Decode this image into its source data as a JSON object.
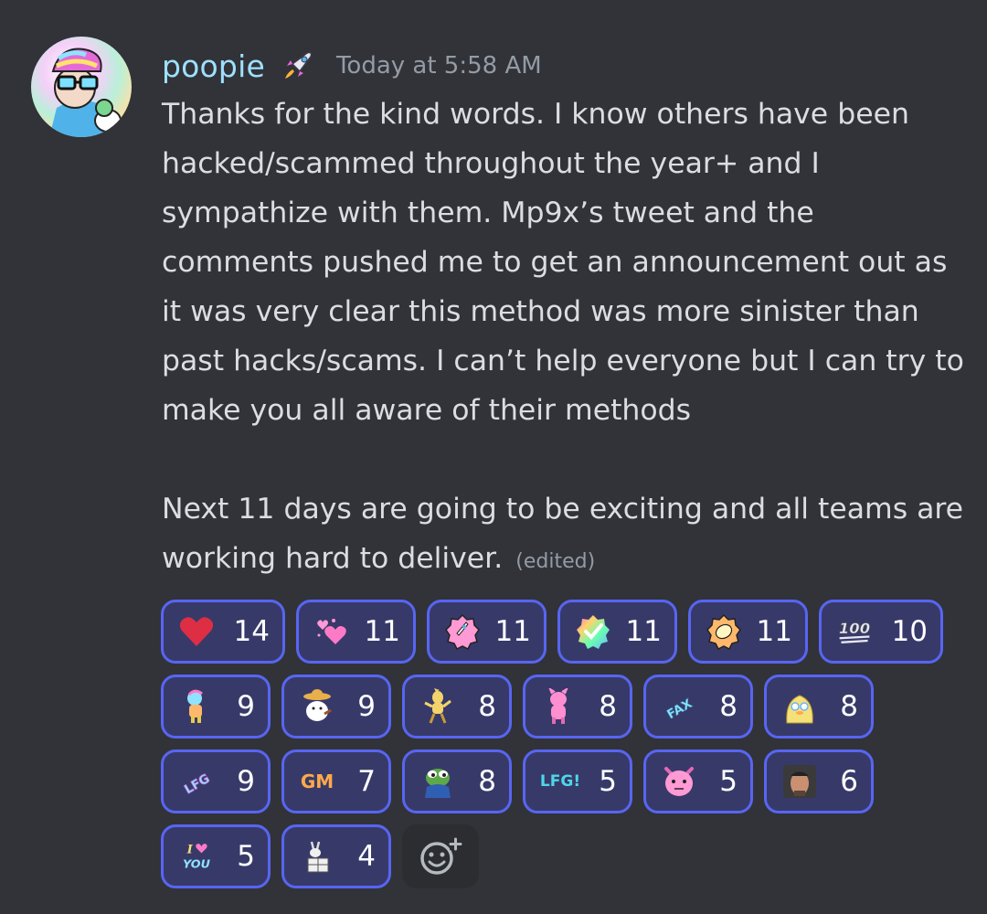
{
  "message": {
    "author": "poopie",
    "timestamp": "Today at 5:58 AM",
    "body": "Thanks for the kind words. I know others have been hacked/scammed throughout the year+ and I sympathize with them. Mp9x’s tweet and the comments pushed me to get an announcement out as it was very clear this method was more sinister than past hacks/scams. I can’t help everyone but I can try to make you all aware of their methods\n\nNext 11 days are going to be exciting and all teams are working hard to deliver.",
    "edited_label": "(edited)"
  },
  "reactions": [
    {
      "icon": "red-heart-icon",
      "count": "14"
    },
    {
      "icon": "pink-hearts-icon",
      "count": "11"
    },
    {
      "icon": "rocket-badge-icon",
      "count": "11"
    },
    {
      "icon": "rainbow-check-badge-icon",
      "count": "11"
    },
    {
      "icon": "lemon-badge-icon",
      "count": "11"
    },
    {
      "icon": "hundred-points-icon",
      "count": "10",
      "text": "100"
    },
    {
      "icon": "rainbow-character-icon",
      "count": "9"
    },
    {
      "icon": "sombrero-sheep-icon",
      "count": "9"
    },
    {
      "icon": "dancing-character-icon",
      "count": "8"
    },
    {
      "icon": "pink-creature-icon",
      "count": "8"
    },
    {
      "icon": "fax-text-icon",
      "count": "8",
      "text": "FAX"
    },
    {
      "icon": "yellow-duck-icon",
      "count": "8"
    },
    {
      "icon": "lfg-text-icon",
      "count": "9",
      "text": "LFG"
    },
    {
      "icon": "gm-text-icon",
      "count": "7",
      "text": "GM"
    },
    {
      "icon": "pepe-frog-icon",
      "count": "8"
    },
    {
      "icon": "lfg-exclaim-text-icon",
      "count": "5",
      "text": "LFG!"
    },
    {
      "icon": "pink-face-icon",
      "count": "5"
    },
    {
      "icon": "man-face-icon",
      "count": "6"
    },
    {
      "icon": "i-love-you-text-icon",
      "count": "5",
      "text_top": "I",
      "text_bottom": "YOU"
    },
    {
      "icon": "goat-box-icon",
      "count": "4"
    }
  ],
  "colors": {
    "background": "#313338",
    "username": "#9ee0ff",
    "text": "#dbdee1",
    "muted": "#949ba4",
    "reaction_border": "#5865f2",
    "reaction_bg": "#373a69"
  }
}
